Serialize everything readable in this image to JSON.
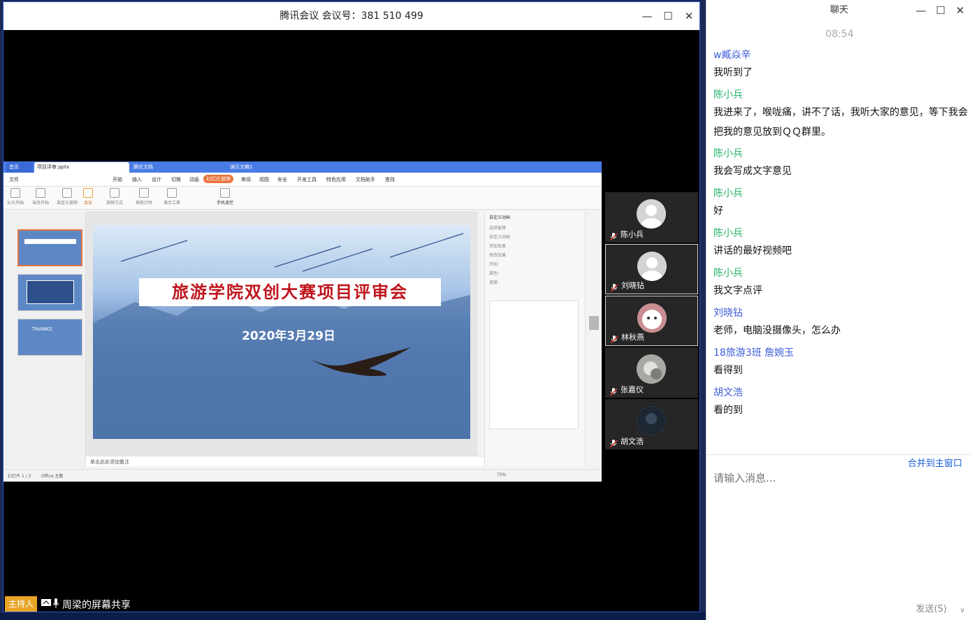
{
  "meeting": {
    "title": "腾讯会议 会议号：381 510 499",
    "min": "—",
    "max": "☐",
    "close": "✕"
  },
  "shared_screen": {
    "tabs": [
      "首页",
      "项目评审.pptx",
      "腾讯文档",
      "演示文稿1"
    ],
    "menus": [
      "文件",
      "开始",
      "插入",
      "设计",
      "切换",
      "动画",
      "幻灯片放映",
      "审阅",
      "视图",
      "安全",
      "开发工具",
      "特色应用",
      "文档助手",
      "查找"
    ],
    "tools": [
      "从头开始",
      "当页开始",
      "自定义放映",
      "会议",
      "放映方式",
      "排练计时",
      "演示工具",
      "手机遥控"
    ],
    "slide_title": "旅游学院双创大赛项目评审会",
    "slide_date": "2020年3月29日",
    "thumb3": "THANKS",
    "notes": "单击此处添加备注",
    "status_left": "幻灯片 1 / 3",
    "status_theme": "Office 主题",
    "status_zoom": "75%",
    "props_title": "自定义动画",
    "props_items": [
      "选择窗格",
      "自定义动画",
      "添加效果",
      "智能动画",
      "删除",
      "修改效果",
      "开始：",
      "属性：",
      "速度："
    ]
  },
  "participants": [
    {
      "name": "陈小兵",
      "active": false,
      "avatar": "default"
    },
    {
      "name": "刘晓钻",
      "active": true,
      "avatar": "default"
    },
    {
      "name": "林秋燕",
      "active": true,
      "avatar": "cat"
    },
    {
      "name": "张嘉仪",
      "active": false,
      "avatar": "photo"
    },
    {
      "name": "胡文浩",
      "active": false,
      "avatar": "dark"
    }
  ],
  "host_bar": {
    "badge": "主持人",
    "text": "周梁的屏幕共享"
  },
  "chat": {
    "title": "聊天",
    "time": "08:54",
    "messages": [
      {
        "name": "w臧焱辛",
        "name_color": "#3b5bd8",
        "text": "我听到了"
      },
      {
        "name": "陈小兵",
        "name_color": "#27b36b",
        "text": "我进来了，喉咙痛，讲不了话，我听大家的意见，等下我会把我的意见放到ＱＱ群里。"
      },
      {
        "name": "陈小兵",
        "name_color": "#27b36b",
        "text": "我会写成文字意见"
      },
      {
        "name": "陈小兵",
        "name_color": "#27b36b",
        "text": "好"
      },
      {
        "name": "陈小兵",
        "name_color": "#27b36b",
        "text": "讲话的最好视频吧"
      },
      {
        "name": "陈小兵",
        "name_color": "#27b36b",
        "text": "我文字点评"
      },
      {
        "name": "刘晓钻",
        "name_color": "#3b5bd8",
        "text": "老师，电脑没摄像头，怎么办"
      },
      {
        "name": "18旅游3班 詹婉玉",
        "name_color": "#3b5bd8",
        "text": "看得到"
      },
      {
        "name": "胡文浩",
        "name_color": "#3b5bd8",
        "text": "看的到"
      }
    ],
    "merge_label": "合并到主窗口",
    "input_placeholder": "请输入消息...",
    "send_label": "发送(S)"
  }
}
